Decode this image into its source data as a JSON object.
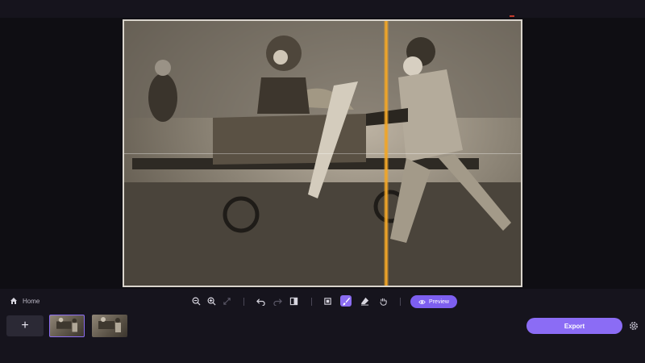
{
  "toolbar": {
    "home_label": "Home",
    "preview_label": "Preview"
  },
  "filmstrip": {
    "add_label": "+",
    "export_label": "Export",
    "thumbnails": [
      {
        "selected": true
      },
      {
        "selected": false
      }
    ]
  },
  "colors": {
    "accent": "#8b6cf5",
    "compare_line": "#f0a528",
    "background": "#16141d"
  },
  "icons": [
    "home-icon",
    "zoom-out-icon",
    "zoom-in-icon",
    "fit-icon",
    "undo-icon",
    "redo-icon",
    "compare-icon",
    "crop-icon",
    "brush-icon",
    "eraser-icon",
    "hand-icon",
    "eye-icon",
    "settings-icon"
  ]
}
